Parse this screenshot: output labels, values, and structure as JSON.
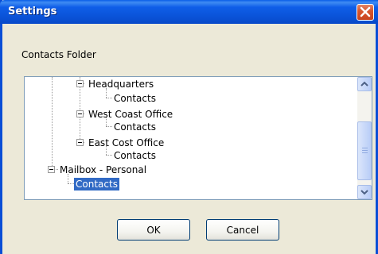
{
  "window": {
    "title": "Settings"
  },
  "dialog": {
    "folder_label": "Contacts Folder",
    "tree": {
      "headquarters": "Headquarters",
      "headquarters_contacts": "Contacts",
      "west_coast": "West Coast Office",
      "west_coast_contacts": "Contacts",
      "east_coast": "East Cost Office",
      "east_coast_contacts": "Contacts",
      "mailbox_personal": "Mailbox - Personal",
      "personal_contacts": "Contacts"
    },
    "selected_item": "Contacts",
    "buttons": {
      "ok": "OK",
      "cancel": "Cancel"
    }
  },
  "colors": {
    "titlebar": "#0a53d8",
    "selection": "#316ac5",
    "close": "#d8562e"
  },
  "icons": [
    "close-icon",
    "collapse-icon",
    "scroll-up-icon",
    "scroll-down-icon"
  ]
}
